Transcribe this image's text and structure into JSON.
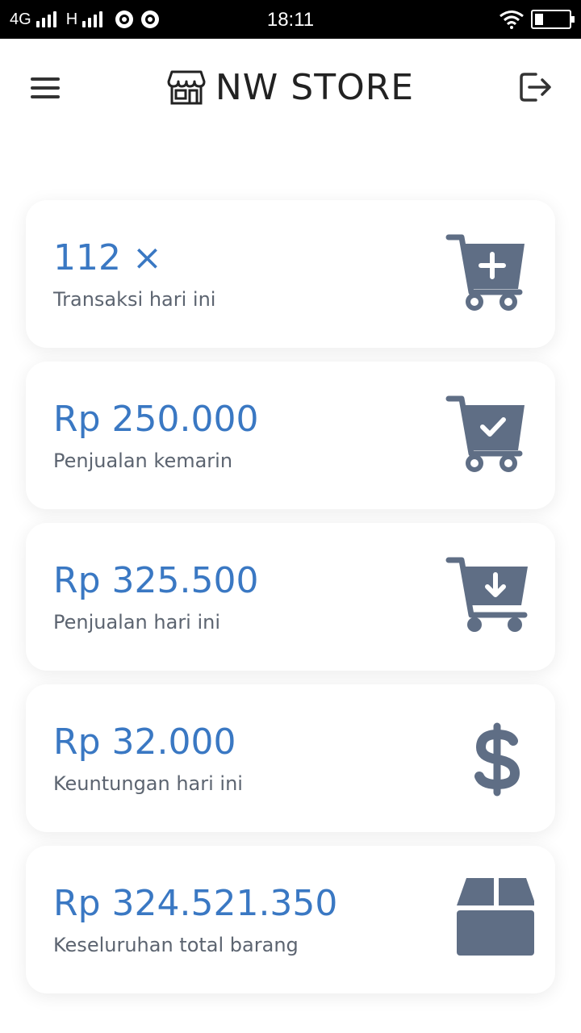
{
  "status_bar": {
    "network_1": "4G",
    "network_2": "H",
    "time": "18:11"
  },
  "header": {
    "title": "NW STORE",
    "icons": {
      "menu": "menu-icon",
      "store": "store-icon",
      "logout": "logout-icon"
    }
  },
  "cards": [
    {
      "value": "112 ×",
      "label": "Transaksi hari ini",
      "icon": "cart-plus-icon"
    },
    {
      "value": "Rp 250.000",
      "label": "Penjualan kemarin",
      "icon": "cart-check-icon"
    },
    {
      "value": "Rp 325.500",
      "label": "Penjualan hari ini",
      "icon": "cart-download-icon"
    },
    {
      "value": "Rp 32.000",
      "label": "Keuntungan hari ini",
      "icon": "dollar-icon"
    },
    {
      "value": "Rp 324.521.350",
      "label": "Keseluruhan total barang",
      "icon": "box-icon"
    }
  ],
  "colors": {
    "accent": "#3a78c3",
    "icon": "#5f6e85",
    "label": "#5c6470"
  }
}
